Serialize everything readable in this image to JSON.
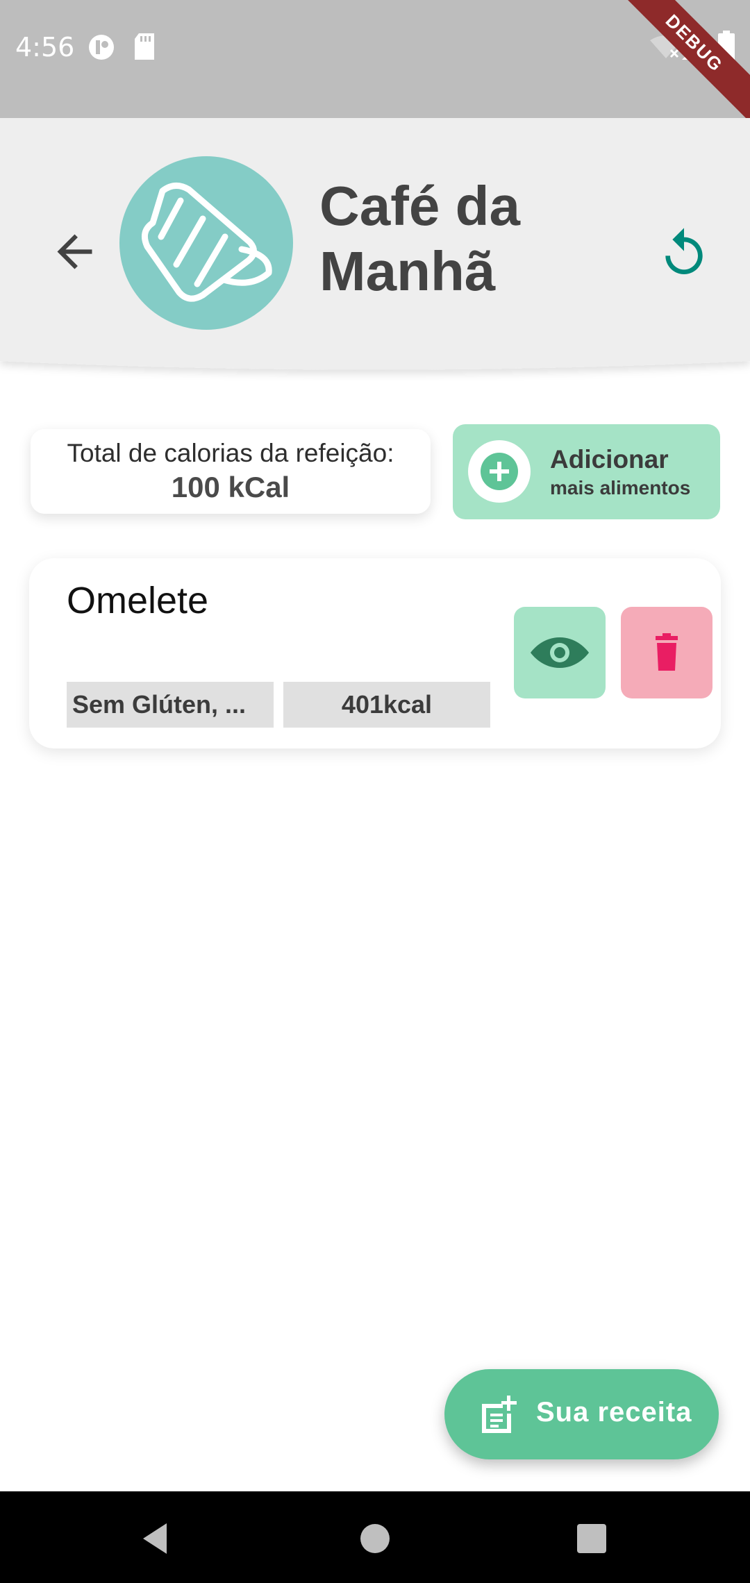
{
  "status_bar": {
    "time": "4:56",
    "debug_label": "DEBUG",
    "icons": [
      "notification-icon",
      "sd-card-icon",
      "wifi-off-icon",
      "signal-icon",
      "battery-icon"
    ]
  },
  "header": {
    "title_line1": "Café da",
    "title_line2": "Manhã",
    "meal_icon": "croissant-icon",
    "back_icon": "arrow-back-icon",
    "reset_icon": "refresh-icon"
  },
  "calories": {
    "label": "Total de calorias da refeição:",
    "value": "100 kCal"
  },
  "add_button": {
    "title": "Adicionar",
    "subtitle": "mais alimentos",
    "icon": "plus-circle-icon"
  },
  "foods": [
    {
      "name": "Omelete",
      "tag": "Sem Glúten, ...",
      "kcal": "401kcal"
    }
  ],
  "fab": {
    "label": "Sua receita",
    "icon": "add-note-icon"
  },
  "colors": {
    "accent": "#5ec497",
    "teal": "#00897b",
    "avatar": "#84ccc6",
    "view": "#a5e3c6",
    "delete": "#f5abb8",
    "delete_icon": "#e91e63"
  }
}
